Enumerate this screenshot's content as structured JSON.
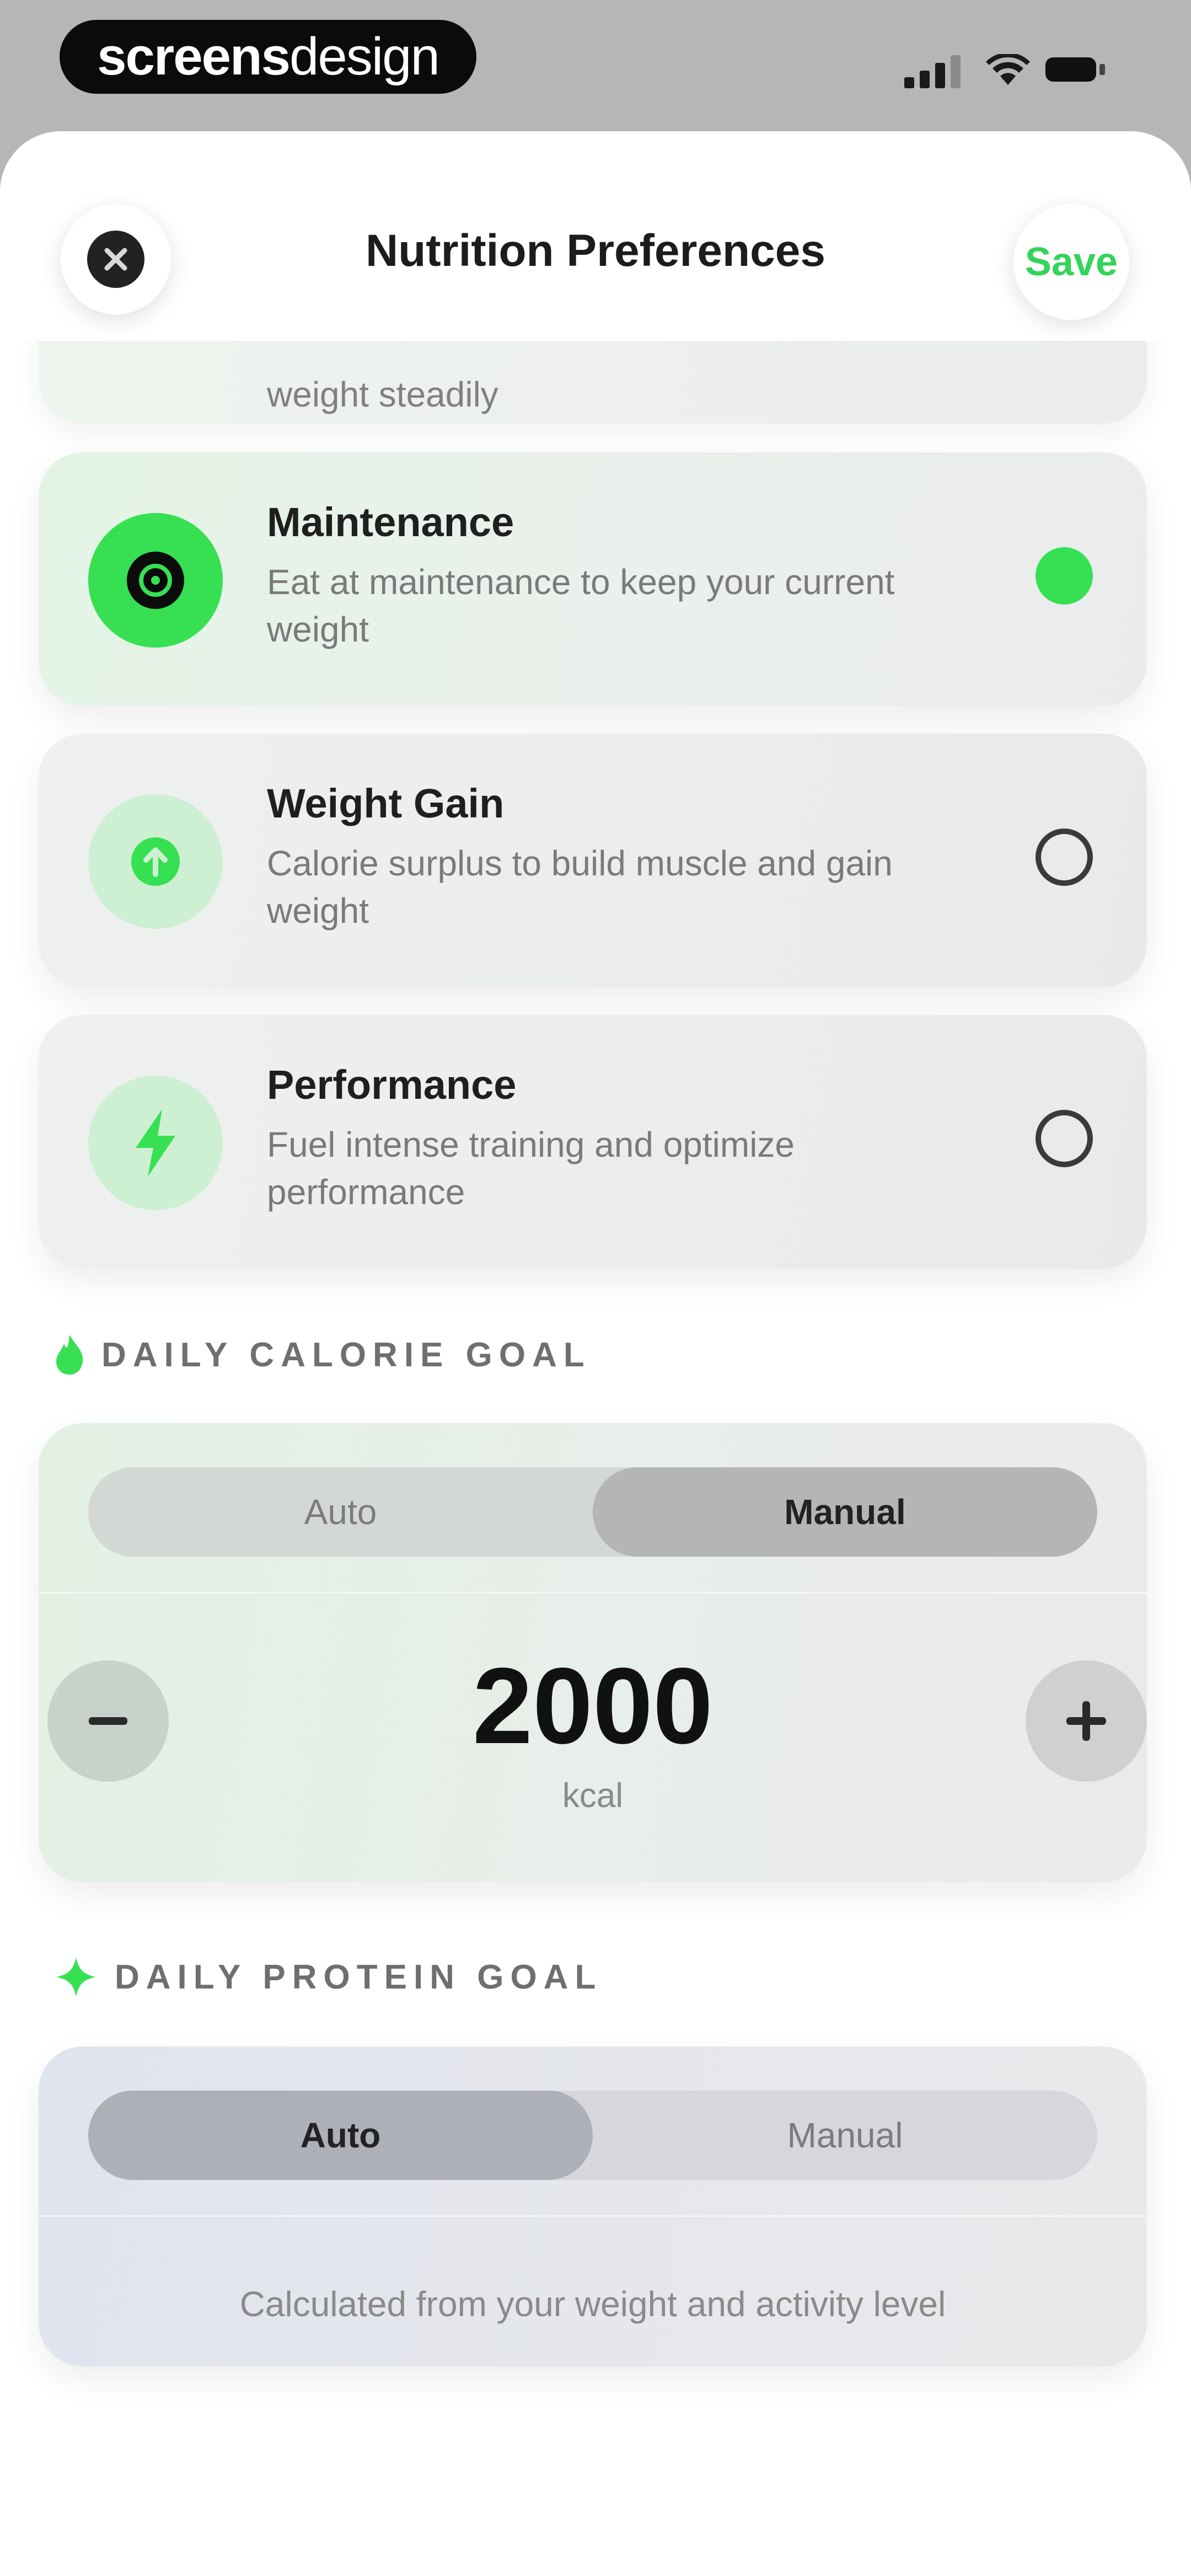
{
  "status_bar": {
    "brand_bold": "screens",
    "brand_light": "design"
  },
  "header": {
    "title": "Nutrition Preferences",
    "save_label": "Save"
  },
  "goal_options": {
    "peek_desc": "weight steadily",
    "items": [
      {
        "title": "Maintenance",
        "description": "Eat at maintenance to keep your current weight",
        "icon": "target-icon",
        "selected": true
      },
      {
        "title": "Weight Gain",
        "description": "Calorie surplus to build muscle and gain weight",
        "icon": "arrow-up-icon",
        "selected": false
      },
      {
        "title": "Performance",
        "description": "Fuel intense training and optimize performance",
        "icon": "lightning-icon",
        "selected": false
      }
    ]
  },
  "calorie_goal": {
    "section_label": "DAILY CALORIE GOAL",
    "mode_auto": "Auto",
    "mode_manual": "Manual",
    "active_mode": "Manual",
    "value": "2000",
    "unit": "kcal"
  },
  "protein_goal": {
    "section_label": "DAILY PROTEIN GOAL",
    "mode_auto": "Auto",
    "mode_manual": "Manual",
    "active_mode": "Auto",
    "note": "Calculated from your weight and activity level"
  },
  "colors": {
    "accent": "#36e052",
    "save_text": "#33d45a",
    "text_primary": "#1f1f1f",
    "text_secondary": "#7a7a7a"
  }
}
